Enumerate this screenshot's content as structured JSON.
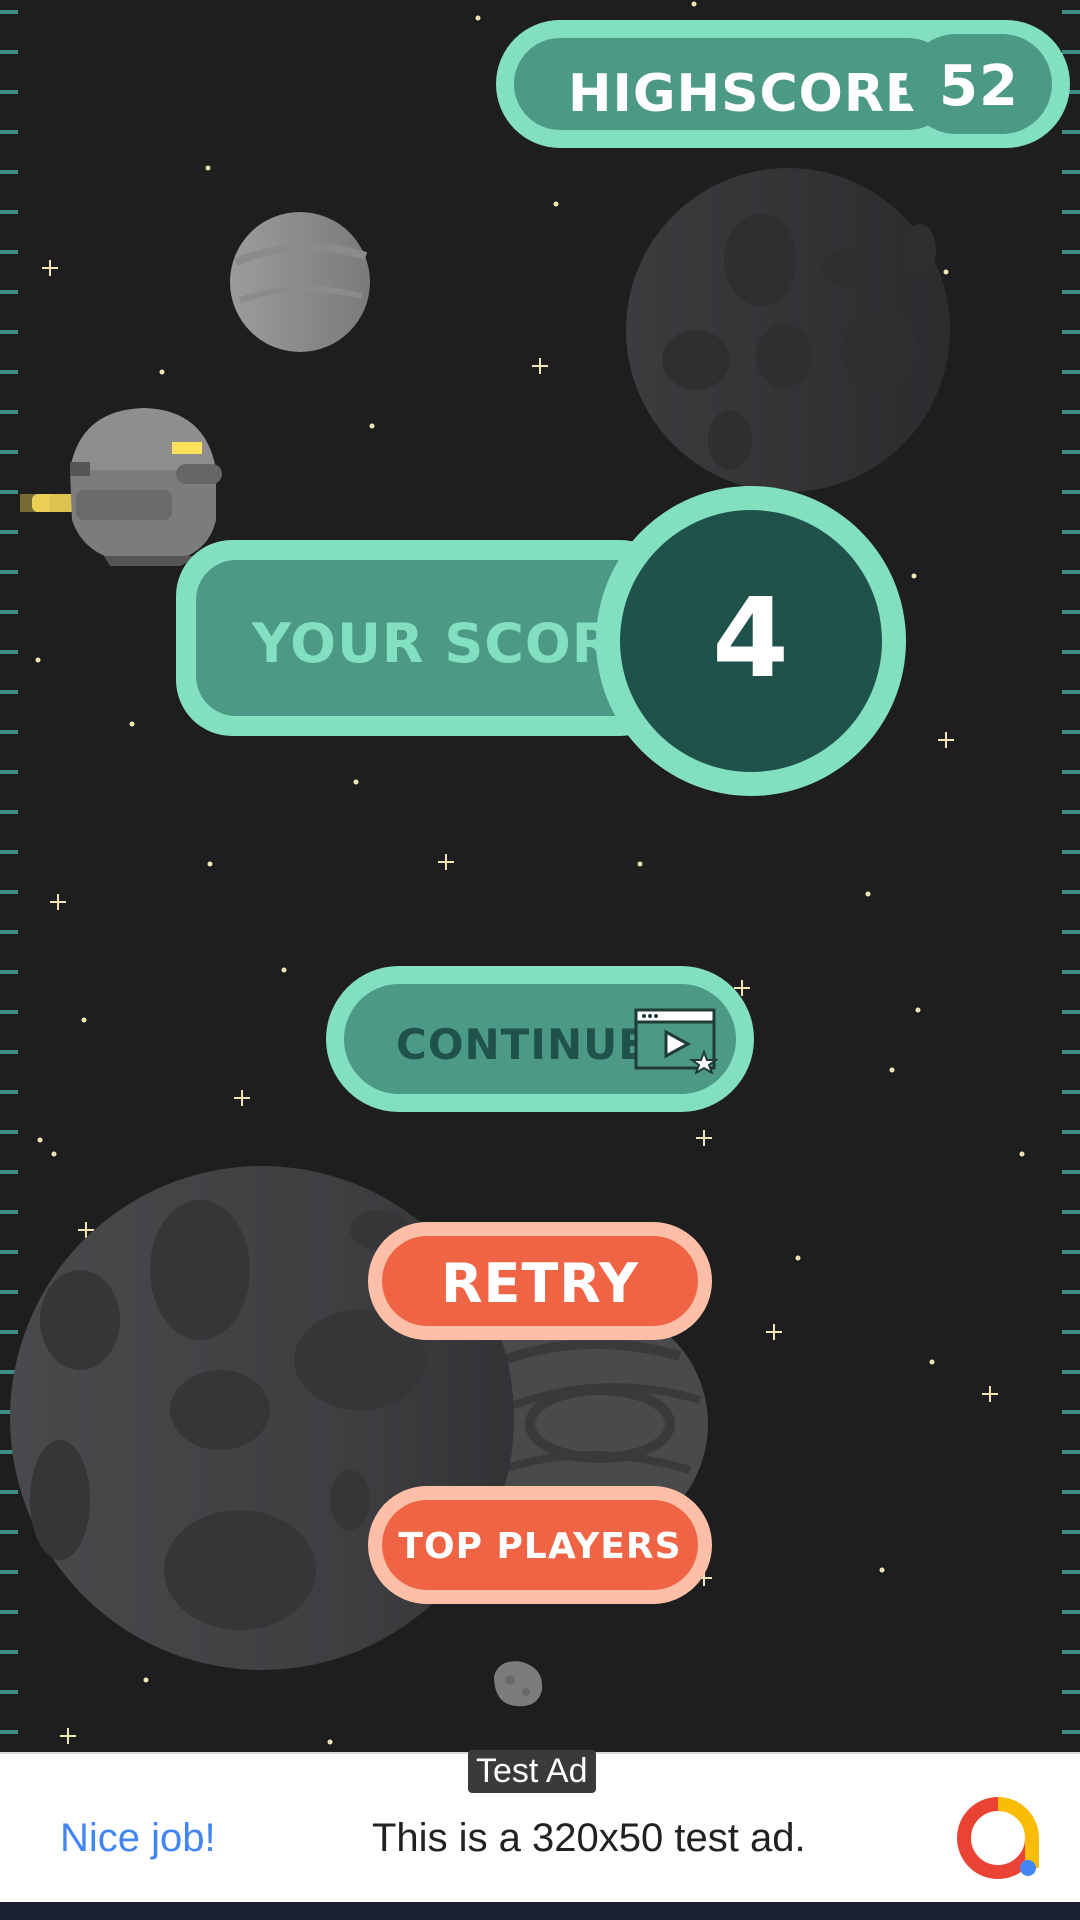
{
  "hud": {
    "highscore_label": "HIGHSCORE",
    "highscore_value": "52",
    "yourscore_label": "YOUR SCORE",
    "yourscore_value": "4"
  },
  "buttons": {
    "continue_label": "CONTINUE",
    "retry_label": "RETRY",
    "top_players_label": "TOP PLAYERS"
  },
  "ad": {
    "tag": "Test Ad",
    "headline": "Nice job!",
    "body": "This is a 320x50 test ad."
  },
  "colors": {
    "space_bg": "#1e1e1f",
    "mint": "#82e0c0",
    "teal": "#4c9a86",
    "dark_teal": "#1f524a",
    "coral": "#ef6444",
    "peach": "#fdbfa8"
  },
  "icons": [
    "rewarded-video-icon",
    "spaceship-icon",
    "planet-icon",
    "asteroid-icon",
    "ad-logo-icon"
  ]
}
